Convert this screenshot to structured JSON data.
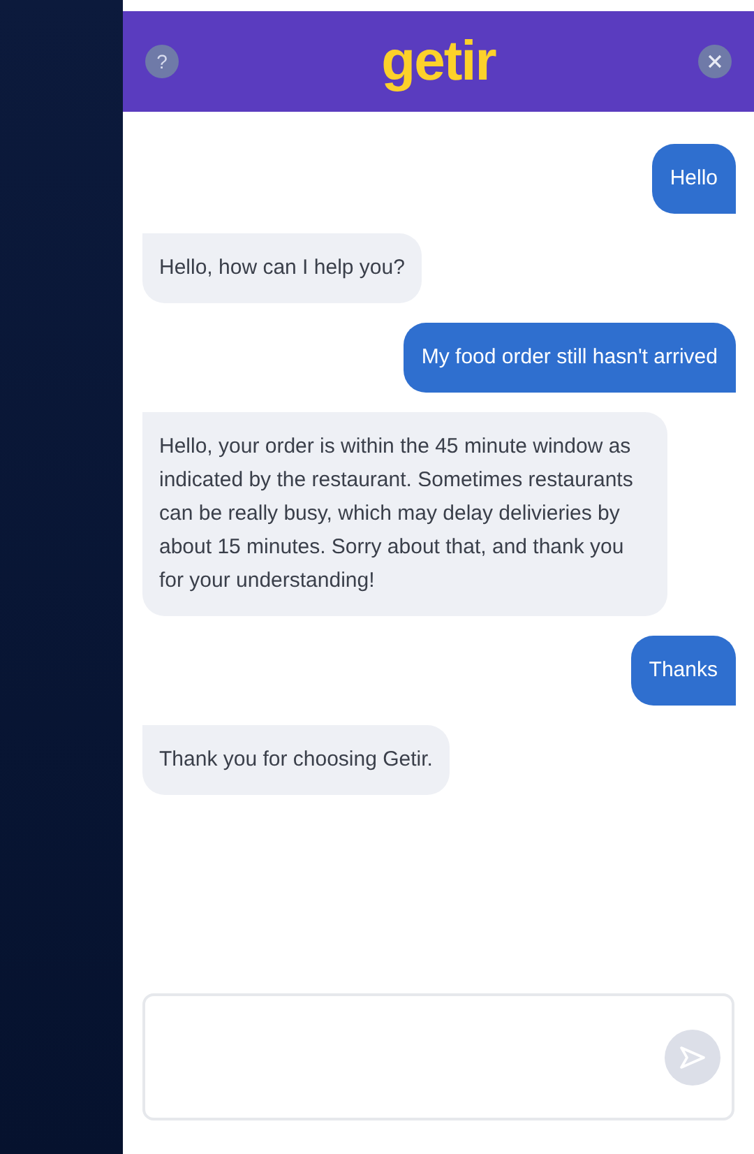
{
  "header": {
    "help": "?",
    "logo": "getir"
  },
  "messages": [
    {
      "kind": "user",
      "text": "Hello"
    },
    {
      "kind": "bot",
      "text": "Hello, how can I help you?"
    },
    {
      "kind": "user",
      "text": "My food order still hasn't arrived"
    },
    {
      "kind": "bot",
      "text": "Hello, your order is within the 45 minute window as indicated by the restaurant. Sometimes restaurants can be really busy, which may delay delivieries by about 15 minutes. Sorry about that, and thank you for your understanding!"
    },
    {
      "kind": "user",
      "text": "Thanks"
    },
    {
      "kind": "bot",
      "text": "Thank you for choosing Getir."
    }
  ],
  "composer": {
    "send_disabled": true
  }
}
